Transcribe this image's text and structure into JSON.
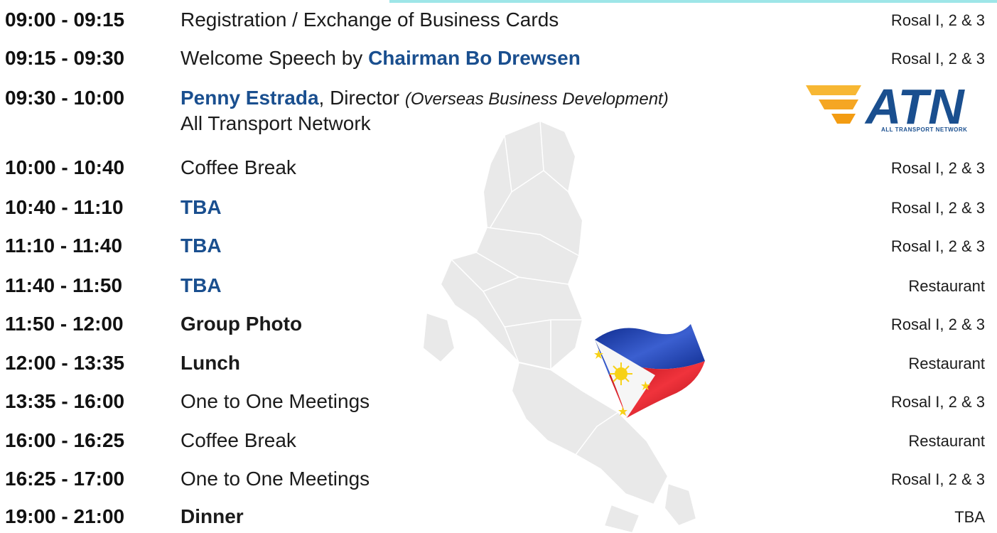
{
  "schedule": [
    {
      "time": "09:00 - 09:15",
      "desc": "Registration / Exchange of Business Cards",
      "venue": "Rosal I, 2 & 3"
    },
    {
      "time": "09:15 - 09:30",
      "desc_prefix": "Welcome Speech by ",
      "highlight": "Chairman Bo Drewsen",
      "venue": "Rosal I, 2 & 3"
    },
    {
      "time": "09:30 - 10:00",
      "highlight": "Penny Estrada",
      "desc_mid": ", Director ",
      "desc_italic": "(Overseas Business Development)",
      "desc_line2": "All Transport Network"
    },
    {
      "time": "10:00 - 10:40",
      "desc": "Coffee Break",
      "venue": "Rosal I, 2 & 3"
    },
    {
      "time": "10:40 - 11:10",
      "highlight": "TBA",
      "venue": "Rosal I, 2 & 3"
    },
    {
      "time": "11:10 - 11:40",
      "highlight": "TBA",
      "venue": "Rosal I, 2 & 3"
    },
    {
      "time": "11:40 - 11:50",
      "highlight": "TBA",
      "venue": "Restaurant"
    },
    {
      "time": "11:50 - 12:00",
      "desc": "Group Photo",
      "venue": "Rosal I, 2 & 3"
    },
    {
      "time": "12:00 - 13:35",
      "desc": "Lunch",
      "venue": "Restaurant"
    },
    {
      "time": "13:35 - 16:00",
      "desc": "One to One Meetings",
      "venue": "Rosal I, 2 & 3"
    },
    {
      "time": "16:00 - 16:25",
      "desc": "Coffee Break",
      "venue": "Restaurant"
    },
    {
      "time": "16:25 - 17:00",
      "desc": "One to One Meetings",
      "venue": "Rosal I, 2 & 3"
    },
    {
      "time": "19:00 - 21:00",
      "desc": "Dinner",
      "venue": "TBA"
    }
  ],
  "logo": {
    "text": "ATN",
    "tagline": "ALL TRANSPORT NETWORK"
  },
  "colors": {
    "highlight": "#1a4f8f",
    "accent_strip": "#9ee6e8",
    "logo_orange": "#f5a623",
    "map_gray": "#e9e9e9",
    "flag_blue": "#1a3fa8",
    "flag_red": "#e01b24",
    "flag_yellow": "#f7d117"
  }
}
